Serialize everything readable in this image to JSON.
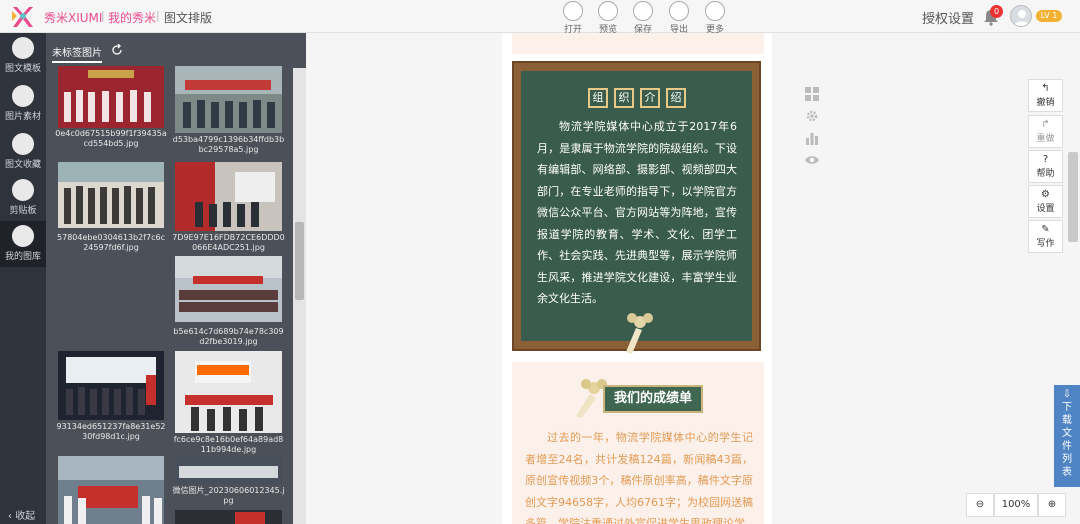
{
  "header": {
    "brand": "秀米XIUMI",
    "breadcrumb": [
      "我的秀米",
      "图文排版"
    ],
    "toolbar": [
      {
        "label": "打开",
        "icon": "folder-icon"
      },
      {
        "label": "预览",
        "icon": "preview-icon"
      },
      {
        "label": "保存",
        "icon": "save-icon"
      },
      {
        "label": "导出",
        "icon": "export-icon"
      },
      {
        "label": "更多",
        "icon": "more-icon"
      }
    ],
    "auth_label": "授权设置",
    "notification_count": "0",
    "level": "LV 1"
  },
  "leftnav": {
    "items": [
      {
        "label": "图文模板",
        "icon": "template-icon"
      },
      {
        "label": "图片素材",
        "icon": "image-icon"
      },
      {
        "label": "图文收藏",
        "icon": "favorite-icon"
      },
      {
        "label": "剪贴板",
        "icon": "clipboard-icon"
      },
      {
        "label": "我的图库",
        "icon": "gallery-icon"
      }
    ],
    "collapse_label": "收起"
  },
  "gallery": {
    "tab": "未标签图片",
    "images": [
      {
        "caption": "0e4c0d67515b99f1f39435acd554bd5.jpg"
      },
      {
        "caption": "d53ba4799c1396b34ffdb3bbc29578a5.jpg"
      },
      {
        "caption": "57804ebe0304613b2f7c6c24597fd6f.jpg"
      },
      {
        "caption": "7D9E97E16FDB72CE6DDD0066E4ADC251.jpg"
      },
      {
        "caption": "b5e614c7d689b74e78c309d2fbe3019.jpg"
      },
      {
        "caption": "93134ed651237fa8e31e5230fd98d1c.jpg"
      },
      {
        "caption": "fc6ce9c8e16b0ef64a89ad811b994de.jpg"
      },
      {
        "caption": ""
      },
      {
        "caption": "微信图片_20230606012345.jpg"
      }
    ]
  },
  "article": {
    "org_title_chars": [
      "组",
      "织",
      "介",
      "绍"
    ],
    "org_text": "物流学院媒体中心成立于2017年6月，是隶属于物流学院的院级组织。下设有编辑部、网络部、摄影部、视频部四大部门，在专业老师的指导下，以学院官方微信公众平台、官方网站等为阵地，宣传报道学院的教育、学术、文化、团学工作、社会实践、先进典型等，展示学院师生风采，推进学院文化建设，丰富学生业余文化生活。",
    "achievement_title": "我们的成绩单",
    "achievement_text": "过去的一年，物流学院媒体中心的学生记者增至24名，共计发稿124篇，新闻稿43篇，原创宣传视频3个，稿件原创率高，稿件文字原创文字94658字，人均6761字；为校园网送稿多篇，学院注重通过外宣促进学生思政理论学"
  },
  "right_tools": [
    {
      "label": "撤销",
      "icon": "undo-icon"
    },
    {
      "label": "重做",
      "icon": "redo-icon"
    },
    {
      "label": "帮助",
      "icon": "help-icon"
    },
    {
      "label": "设置",
      "icon": "settings-icon"
    },
    {
      "label": "写作",
      "icon": "write-icon"
    }
  ],
  "download_label": "下载文件列表",
  "zoom": {
    "value": "100%"
  },
  "colors": {
    "brand": "#e94b8c",
    "board": "#3a5c4d",
    "frame": "#8c6037",
    "accent_text": "#e39a55",
    "download": "#4f85c5"
  }
}
